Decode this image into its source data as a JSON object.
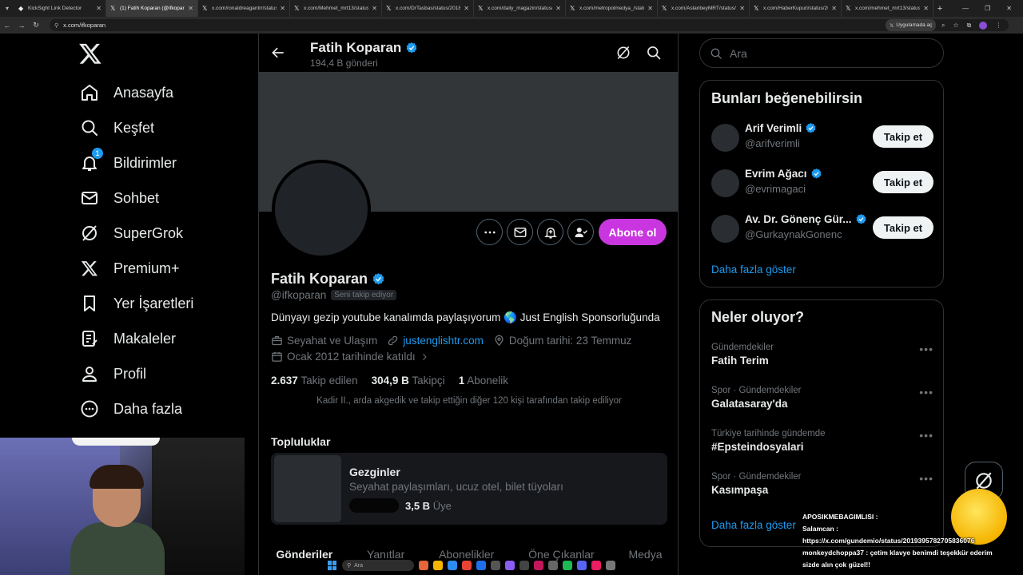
{
  "browser": {
    "tabs": [
      {
        "title": "KickSight Link Detector",
        "active": false
      },
      {
        "title": "(1) Fatih Koparan (@ifkoparan",
        "active": true
      },
      {
        "title": "x.com/ronaldreagantrr/status",
        "active": false
      },
      {
        "title": "x.com/Mehmet_mrt13/status",
        "active": false
      },
      {
        "title": "x.com/DrTasbas/status/2018",
        "active": false
      },
      {
        "title": "x.com/daily_magazin/status/2",
        "active": false
      },
      {
        "title": "x.com/metropolmedya_/statu",
        "active": false
      },
      {
        "title": "x.com/AslanbeyMRT/status/20",
        "active": false
      },
      {
        "title": "x.com/HaberKupuri/status/20",
        "active": false
      },
      {
        "title": "x.com/mehmet_mrt13/status",
        "active": false
      }
    ],
    "url": "x.com/ifkoparan",
    "app_chip": "Uygulamada aç"
  },
  "nav": {
    "items": [
      {
        "label": "Anasayfa",
        "icon": "home-icon"
      },
      {
        "label": "Keşfet",
        "icon": "search-icon"
      },
      {
        "label": "Bildirimler",
        "icon": "bell-icon",
        "badge": "1"
      },
      {
        "label": "Sohbet",
        "icon": "mail-icon"
      },
      {
        "label": "SuperGrok",
        "icon": "grok-icon"
      },
      {
        "label": "Premium+",
        "icon": "x-logo-icon"
      },
      {
        "label": "Yer İşaretleri",
        "icon": "bookmark-icon"
      },
      {
        "label": "Makaleler",
        "icon": "article-icon"
      },
      {
        "label": "Profil",
        "icon": "person-icon"
      },
      {
        "label": "Daha fazla",
        "icon": "more-circle-icon"
      }
    ]
  },
  "header": {
    "name": "Fatih Koparan",
    "post_count": "194,4 B gönderi"
  },
  "profile": {
    "name": "Fatih Koparan",
    "handle": "@ifkoparan",
    "follows_you": "Seni takip ediyor",
    "bio": "Dünyayı gezip youtube kanalımda paylaşıyorum 🌎 Just English Sponsorluğunda",
    "category": "Seyahat ve Ulaşım",
    "website": "justenglishtr.com",
    "birthday": "Doğum tarihi: 23 Temmuz",
    "joined": "Ocak 2012 tarihinde katıldı",
    "following_count": "2.637",
    "following_label": "Takip edilen",
    "followers_count": "304,9 B",
    "followers_label": "Takipçi",
    "subscriptions_count": "1",
    "subscriptions_label": "Abonelik",
    "followed_by": "Kadir II., arda akgedik ve takip ettiğin diğer 120 kişi tarafından takip ediliyor",
    "subscribe_label": "Abone ol"
  },
  "communities": {
    "title": "Topluluklar",
    "items": [
      {
        "name": "Gezginler",
        "description": "Seyahat paylaşımları, ucuz otel, bilet tüyoları",
        "members_count": "3,5 B",
        "members_label": "Üye"
      }
    ]
  },
  "profile_tabs": [
    "Gönderiler",
    "Yanıtlar",
    "Abonelikler",
    "Öne Çıkanlar",
    "Medya"
  ],
  "search": {
    "placeholder": "Ara"
  },
  "suggestions": {
    "title": "Bunları beğenebilirsin",
    "items": [
      {
        "name": "Arif Verimli",
        "handle": "@arifverimli",
        "button": "Takip et"
      },
      {
        "name": "Evrim Ağacı",
        "handle": "@evrimagaci",
        "button": "Takip et"
      },
      {
        "name": "Av. Dr. Gönenç Gür...",
        "handle": "@GurkaynakGonenc",
        "button": "Takip et"
      }
    ],
    "show_more": "Daha fazla göster"
  },
  "trends": {
    "title": "Neler oluyor?",
    "items": [
      {
        "category": "Gündemdekiler",
        "name": "Fatih Terim"
      },
      {
        "category": "Spor · Gündemdekiler",
        "name": "Galatasaray'da"
      },
      {
        "category": "Türkiye tarihinde gündemde",
        "name": "#Epsteindosyalari"
      },
      {
        "category": "Spor · Gündemdekiler",
        "name": "Kasımpaşa"
      }
    ],
    "show_more": "Daha fazla göster"
  },
  "chat_overlay": {
    "messages": [
      {
        "user": "APOSIKMEBAGIMLISI :",
        "text": ""
      },
      {
        "user": "Salamcan :",
        "text": "https://x.com/gundemio/status/2019395782705836076"
      },
      {
        "user": "monkeydchoppa37 :",
        "text": "çetim klavye benimdi teşekkür ederim sizde alın çok güzel!!"
      }
    ]
  },
  "taskbar": {
    "search_label": "Ara"
  },
  "colors": {
    "accent": "#1d9bf0",
    "subscribe": "#c936e0",
    "background": "#000000",
    "muted": "#71767b"
  }
}
